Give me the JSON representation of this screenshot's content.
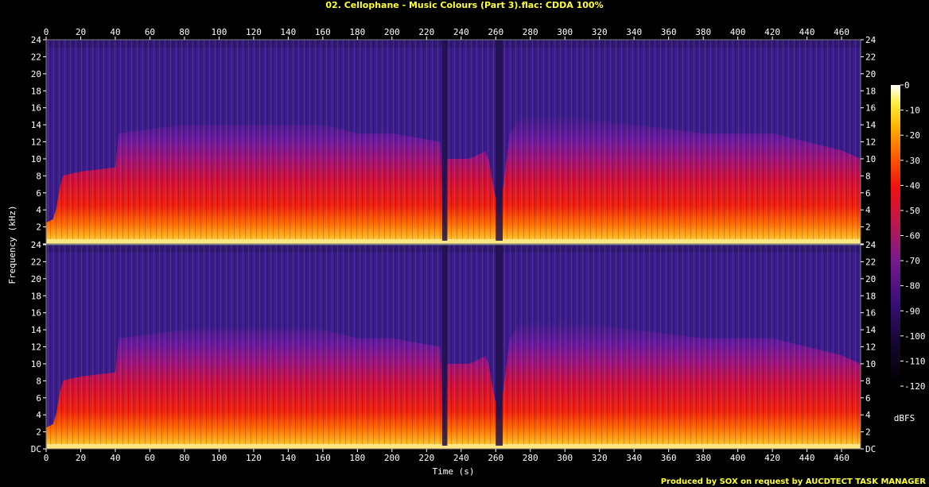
{
  "chart_data": {
    "type": "heatmap",
    "title": "02. Cellophane - Music Colours (Part 3).flac: CDDA 100%",
    "xlabel": "Time (s)",
    "ylabel": "Frequency (kHz)",
    "xlim": [
      0,
      471
    ],
    "ylim": [
      0,
      24
    ],
    "x_ticks": [
      "0",
      "20",
      "40",
      "60",
      "80",
      "100",
      "120",
      "140",
      "160",
      "180",
      "200",
      "220",
      "240",
      "260",
      "280",
      "300",
      "320",
      "340",
      "360",
      "380",
      "400",
      "420",
      "440",
      "460"
    ],
    "y_ticks": [
      "DC",
      "2",
      "4",
      "6",
      "8",
      "10",
      "12",
      "14",
      "16",
      "18",
      "20",
      "22",
      "24"
    ],
    "channels": 2,
    "colorbar": {
      "label": "dBFS",
      "ticks": [
        "0",
        "-10",
        "-20",
        "-30",
        "-40",
        "-50",
        "-60",
        "-70",
        "-80",
        "-90",
        "-100",
        "-110",
        "-120"
      ],
      "range": [
        -120,
        0
      ]
    },
    "spectral_energy_profile": {
      "x": [
        0,
        5,
        9,
        20,
        40,
        42,
        80,
        120,
        160,
        180,
        200,
        228,
        230,
        232,
        245,
        255,
        262,
        268,
        275,
        300,
        340,
        380,
        400,
        420,
        440,
        460,
        471
      ],
      "cutoff_khz": [
        2.5,
        3,
        8,
        8.5,
        9,
        13,
        14,
        14,
        14,
        13,
        13,
        12,
        2,
        10,
        10,
        11,
        3,
        13,
        15,
        15,
        14,
        13,
        13,
        13,
        12,
        11,
        10
      ]
    }
  },
  "credit": "Produced by SOX on request by AUCDTECT TASK MANAGER"
}
